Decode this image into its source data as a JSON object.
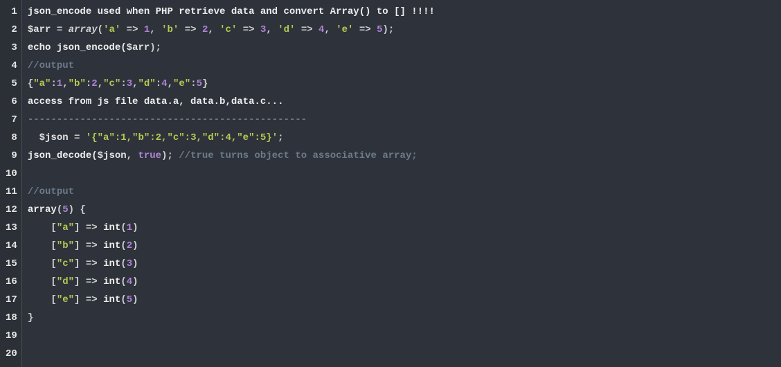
{
  "lineNumbers": [
    "1",
    "2",
    "3",
    "4",
    "5",
    "6",
    "7",
    "8",
    "9",
    "10",
    "11",
    "12",
    "13",
    "14",
    "15",
    "16",
    "17",
    "18",
    "19",
    "20"
  ],
  "lines": {
    "l1": {
      "a": "json_encode used when PHP retrieve data and convert Array() to [] !!!!"
    },
    "l2": {
      "a": "$arr",
      "b": " = ",
      "c": "array",
      "d": "(",
      "e": "'a'",
      "f": " => ",
      "g": "1",
      "h": ", ",
      "i": "'b'",
      "j": " => ",
      "k": "2",
      "l": ", ",
      "m": "'c'",
      "n": " => ",
      "o": "3",
      "p": ", ",
      "q": "'d'",
      "r": " => ",
      "s": "4",
      "t": ", ",
      "u": "'e'",
      "v": " => ",
      "w": "5",
      "x": ");"
    },
    "l3": {
      "a": "echo",
      "b": " json_encode(",
      "c": "$arr",
      "d": ");"
    },
    "l4": {
      "a": "//output"
    },
    "l5": {
      "a": "{",
      "b": "\"a\"",
      "c": ":",
      "d": "1",
      "e": ",",
      "f": "\"b\"",
      "g": ":",
      "h": "2",
      "i": ",",
      "j": "\"c\"",
      "k": ":",
      "l": "3",
      "m": ",",
      "n": "\"d\"",
      "o": ":",
      "p": "4",
      "q": ",",
      "r": "\"e\"",
      "s": ":",
      "t": "5",
      "u": "}"
    },
    "l6": {
      "a": "access from js file data.a, data.b,data.c..."
    },
    "l7": {
      "a": "------------------------------------------------"
    },
    "l8": {
      "a": "  $json",
      "b": " = ",
      "c": "'{\"a\":1,\"b\":2,\"c\":3,\"d\":4,\"e\":5}'",
      "d": ";"
    },
    "l9": {
      "a": "json_decode(",
      "b": "$json",
      "c": ", ",
      "d": "true",
      "e": "); ",
      "f": "//true turns object to associative array;"
    },
    "l10": {
      "a": ""
    },
    "l11": {
      "a": "//output"
    },
    "l12": {
      "a": "array",
      "b": "(",
      "c": "5",
      "d": ") {"
    },
    "l13": {
      "a": "    [",
      "b": "\"a\"",
      "c": "] => ",
      "d": "int",
      "e": "(",
      "f": "1",
      "g": ")"
    },
    "l14": {
      "a": "    [",
      "b": "\"b\"",
      "c": "] => ",
      "d": "int",
      "e": "(",
      "f": "2",
      "g": ")"
    },
    "l15": {
      "a": "    [",
      "b": "\"c\"",
      "c": "] => ",
      "d": "int",
      "e": "(",
      "f": "3",
      "g": ")"
    },
    "l16": {
      "a": "    [",
      "b": "\"d\"",
      "c": "] => ",
      "d": "int",
      "e": "(",
      "f": "4",
      "g": ")"
    },
    "l17": {
      "a": "    [",
      "b": "\"e\"",
      "c": "] => ",
      "d": "int",
      "e": "(",
      "f": "5",
      "g": ")"
    },
    "l18": {
      "a": "}"
    },
    "l19": {
      "a": ""
    },
    "l20": {
      "a": ""
    }
  }
}
